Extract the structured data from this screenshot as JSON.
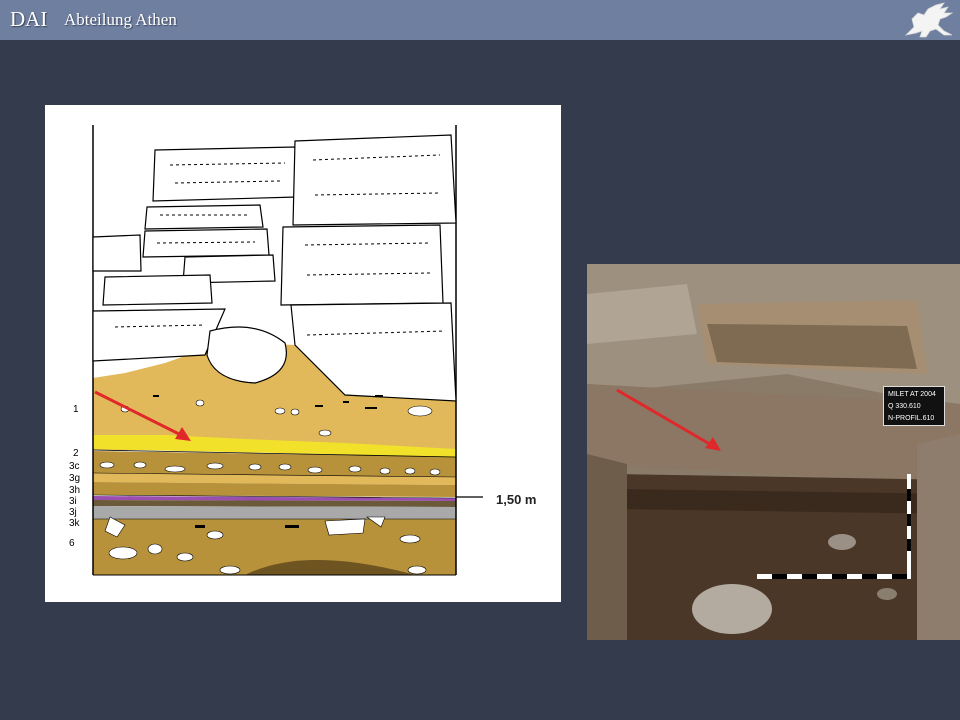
{
  "header": {
    "brand": "DAI",
    "subtitle": "Abteilung Athen",
    "logo_icon": "griffin-logo-icon"
  },
  "drawing": {
    "layer_labels": [
      {
        "id": "1",
        "text": "1"
      },
      {
        "id": "2",
        "text": "2"
      },
      {
        "id": "3c",
        "text": "3c"
      },
      {
        "id": "3g",
        "text": "3g"
      },
      {
        "id": "3h",
        "text": "3h"
      },
      {
        "id": "3i",
        "text": "3i"
      },
      {
        "id": "3j",
        "text": "3j"
      },
      {
        "id": "3k",
        "text": "3k"
      },
      {
        "id": "6",
        "text": "6"
      }
    ],
    "depth_marker": "1,50 m",
    "colors": {
      "ochre_fill": "#e2b95a",
      "yellow_band": "#f2e12a",
      "brown_band": "#b8923a",
      "purple_band": "#9a4fb0",
      "grey_band": "#a9a9a9",
      "dark_soil": "#8d6d2c",
      "arrow": "#e0282a"
    }
  },
  "photo": {
    "label_lines": [
      "MILET AT 2004",
      "Q 330.610",
      "N-PROFIL.610"
    ],
    "arrow_color": "#e0282a"
  }
}
